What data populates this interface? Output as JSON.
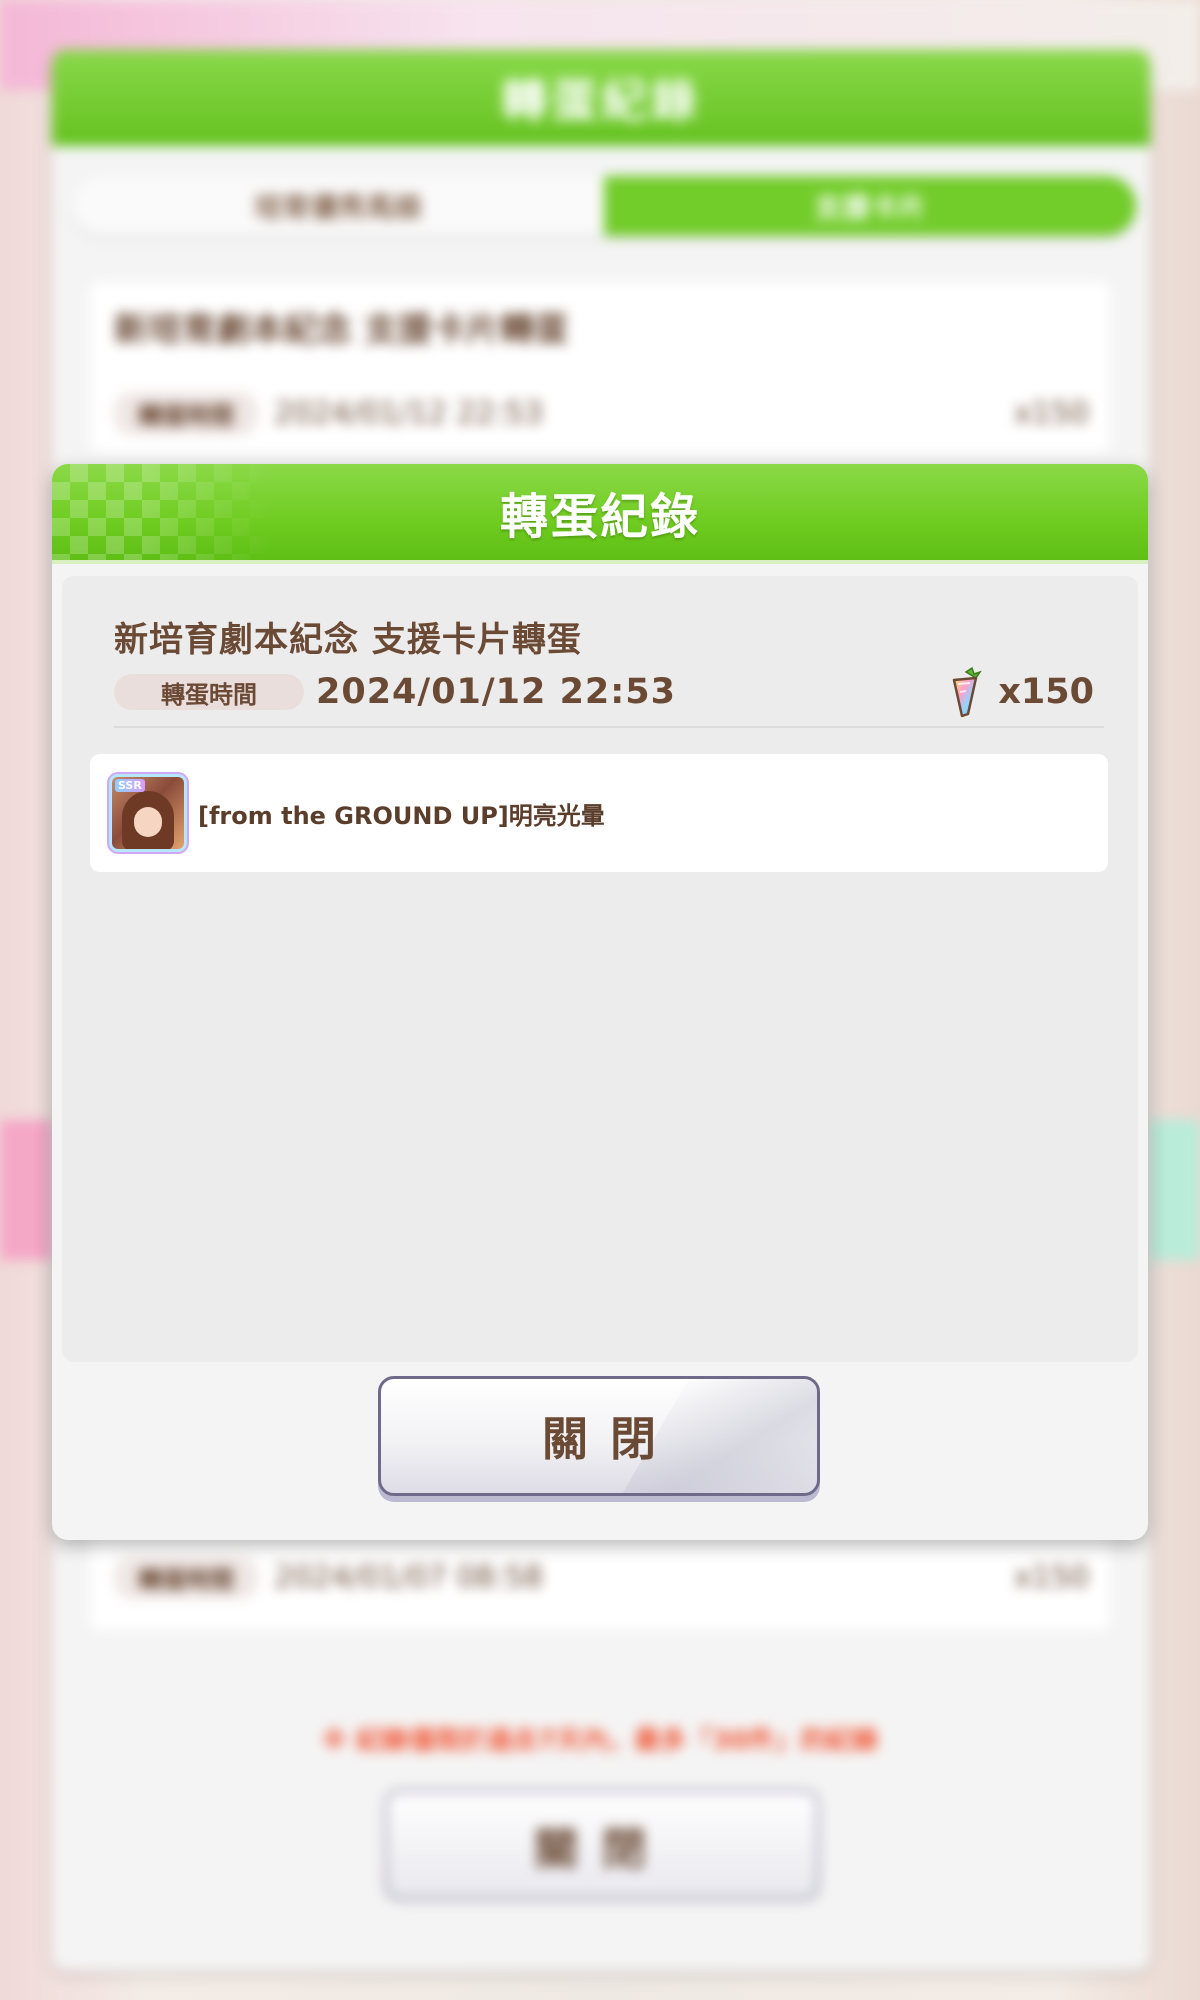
{
  "background": {
    "window_title": "轉蛋紀錄",
    "tabs": [
      {
        "label": "培育優秀馬娘",
        "active": false
      },
      {
        "label": "支援卡片",
        "active": true
      }
    ],
    "records": [
      {
        "name": "新培育劇本紀念 支援卡片轉蛋",
        "time_label": "轉蛋時間",
        "time": "2024/01/12 22:53",
        "cost": "x150"
      },
      {
        "time_label": "轉蛋時間",
        "time": "2024/01/07 08:58",
        "cost": "x150"
      }
    ],
    "note": "※ 紀錄僅限於過去7天內，最多「30件」的紀錄",
    "close_label": "關閉"
  },
  "dialog": {
    "title": "轉蛋紀錄",
    "gacha_name": "新培育劇本紀念 支援卡片轉蛋",
    "time_label": "轉蛋時間",
    "time_value": "2024/01/12 22:53",
    "cost": "x150",
    "cost_icon": "carrot-jewel-icon",
    "results": [
      {
        "rarity": "SSR",
        "name": "[from the GROUND UP]明亮光暈",
        "icon": "support-card-thumbnail"
      }
    ],
    "close_label": "關閉"
  },
  "colors": {
    "header_green": "#6fcc20",
    "text_brown": "#6b4a35",
    "note_red": "#f05a3a"
  }
}
